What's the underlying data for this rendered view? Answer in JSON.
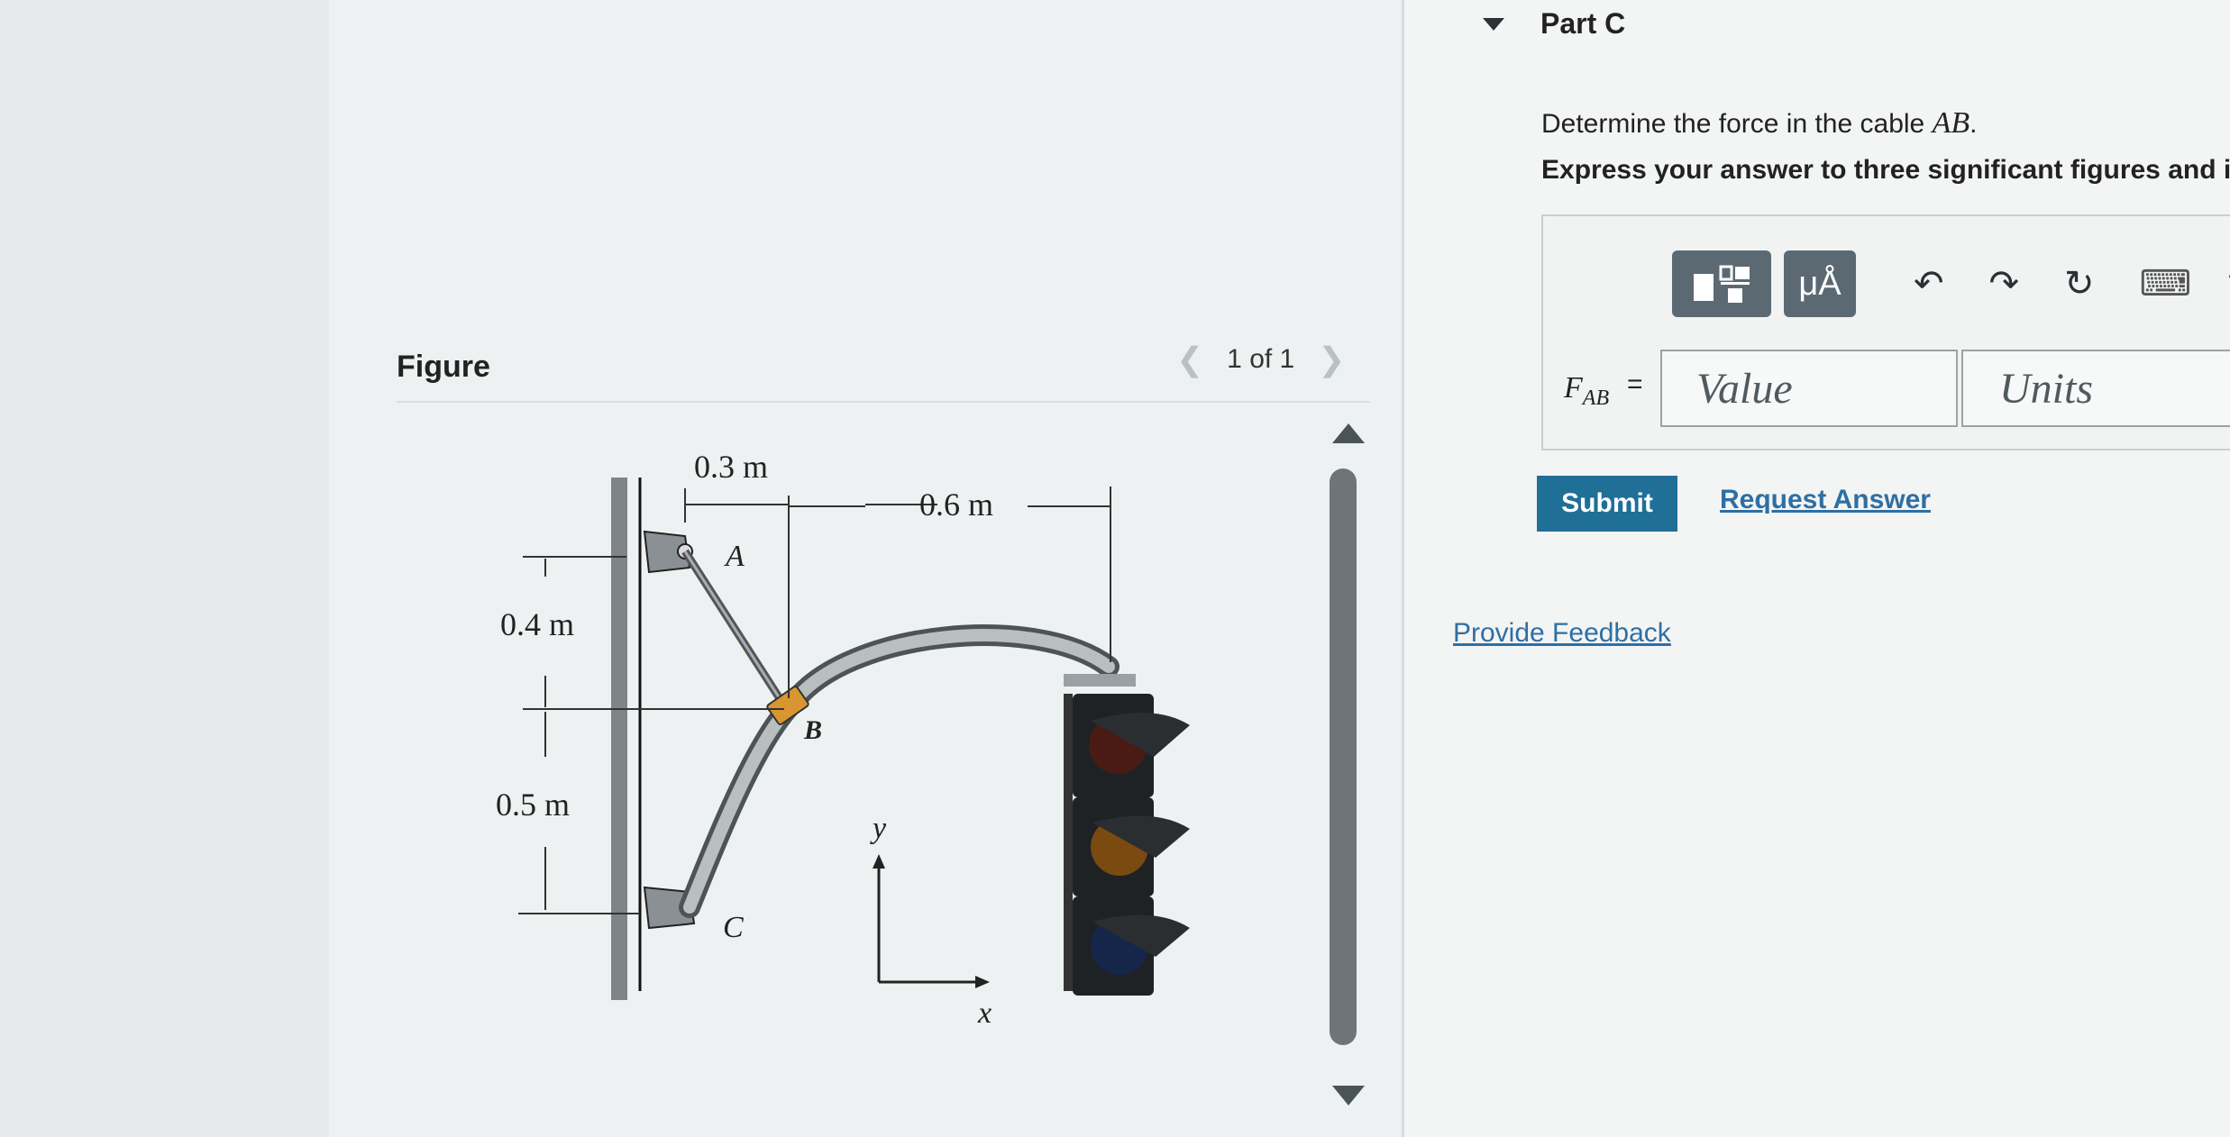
{
  "figure": {
    "label": "Figure",
    "pager_text": "1 of 1",
    "prev_icon": "chevron-left-icon",
    "next_icon": "chevron-right-icon"
  },
  "diagram": {
    "dim_top_left": "0.3 m",
    "dim_top_right": "0.6 m",
    "dim_left_upper": "0.4 m",
    "dim_left_lower": "0.5 m",
    "point_a": "A",
    "point_b": "B",
    "point_c": "C",
    "axis_x": "x",
    "axis_y": "y"
  },
  "part": {
    "title": "Part C",
    "question_text": "Determine the force in the cable ",
    "question_var": "AB",
    "question_end": ".",
    "instruction": "Express your answer to three significant figures and i"
  },
  "toolbar": {
    "templates_icon": "templates-icon",
    "units_symbol": "μÅ",
    "undo_icon": "undo-icon",
    "redo_icon": "redo-icon",
    "reset_icon": "reset-icon",
    "keyboard_icon": "keyboard-icon",
    "help_label": "?"
  },
  "answer": {
    "var_main": "F",
    "var_sub": "AB",
    "equals": "=",
    "value_placeholder": "Value",
    "units_placeholder": "Units"
  },
  "actions": {
    "submit": "Submit",
    "request_answer": "Request Answer",
    "feedback": "Provide Feedback"
  }
}
